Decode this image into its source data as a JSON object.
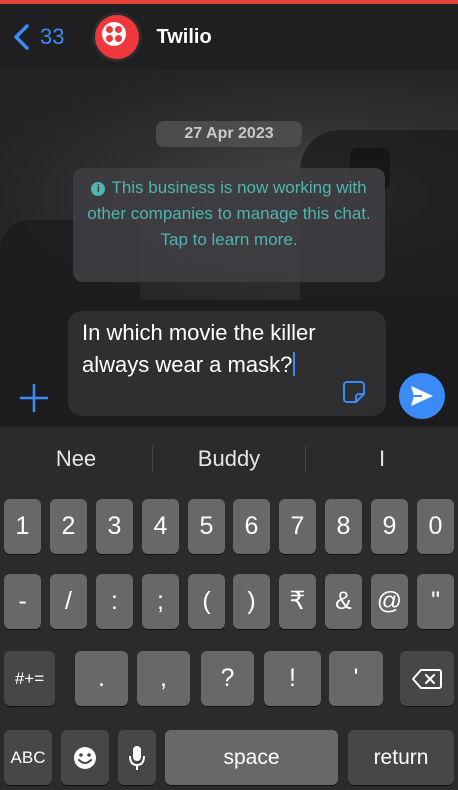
{
  "header": {
    "back_count": "33",
    "contact_name": "Twilio"
  },
  "chat": {
    "date_chip": "27 Apr 2023",
    "system_message": "This business is now working with other companies to manage this chat. Tap to learn more."
  },
  "composer": {
    "input_value": "In which movie the killer always wear a mask?"
  },
  "keyboard": {
    "suggestions": [
      "Nee",
      "Buddy",
      "I"
    ],
    "row1": [
      "1",
      "2",
      "3",
      "4",
      "5",
      "6",
      "7",
      "8",
      "9",
      "0"
    ],
    "row2": [
      "-",
      "/",
      ":",
      ";",
      "(",
      ")",
      "₹",
      "&",
      "@",
      "\""
    ],
    "row3": {
      "symbols": "#+=",
      "keys": [
        ".",
        ",",
        "?",
        "!",
        "'"
      ]
    },
    "row4": {
      "abc": "ABC",
      "space": "space",
      "return": "return"
    }
  },
  "colors": {
    "accent": "#3a8bf5",
    "brand": "#f0383c",
    "system_text": "#52b4b0",
    "key": "#68686b",
    "key_dark": "#474749"
  }
}
